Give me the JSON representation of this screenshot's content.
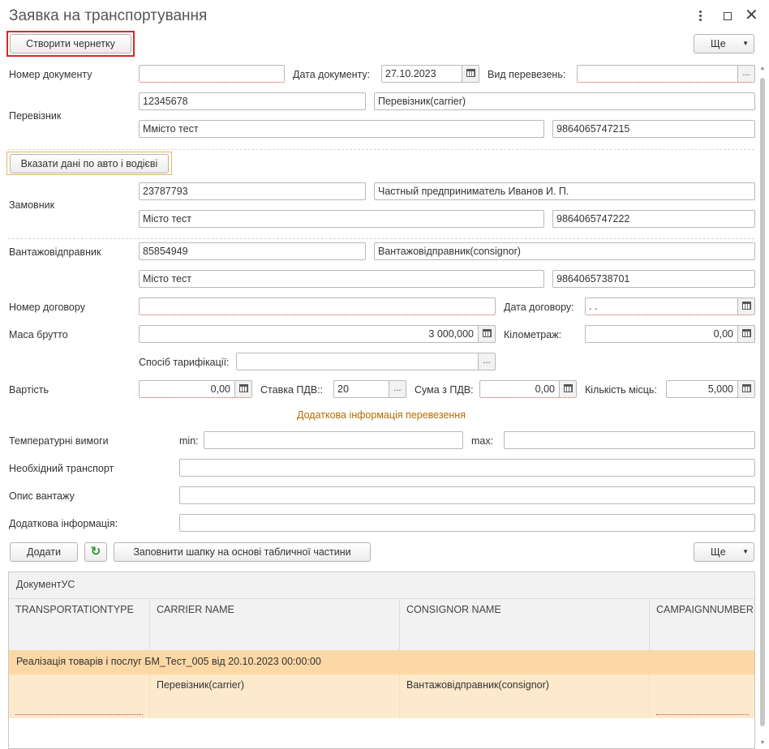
{
  "window": {
    "title": "Заявка на транспортування"
  },
  "toolbar": {
    "create_draft_label": "Створити чернетку",
    "more_label": "Ще"
  },
  "header": {
    "doc_number_label": "Номер документу",
    "doc_number_value": "",
    "doc_date_label": "Дата документу:",
    "doc_date_value": "27.10.2023",
    "transport_type_label": "Вид перевезень:",
    "transport_type_value": ""
  },
  "carrier": {
    "label": "Перевізник",
    "code": "12345678",
    "name": "Перевізник(carrier)",
    "city": "Ммісто тест",
    "phone": "9864065747215",
    "vehicle_button": "Вказати дані по авто і водієві"
  },
  "customer": {
    "label": "Замовник",
    "code": "23787793",
    "name": "Частный предприниматель Иванов И. П.",
    "city": "Місто тест",
    "phone": "9864065747222"
  },
  "consignor": {
    "label": "Вантажовідправник",
    "code": "85854949",
    "name": "Вантажовідправник(consignor)",
    "city": "Місто тест",
    "phone": "9864065738701"
  },
  "contract": {
    "number_label": "Номер договору",
    "number_value": "",
    "date_label": "Дата договору:",
    "date_value": " .  .",
    "gross_label": "Маса брутто",
    "gross_value": "3 000,000",
    "km_label": "Кілометраж:",
    "km_value": "0,00",
    "tariff_label": "Спосіб тарифікації:",
    "tariff_value": ""
  },
  "cost": {
    "label": "Вартість",
    "value": "0,00",
    "vat_rate_label": "Ставка ПДВ::",
    "vat_rate_value": "20",
    "sum_vat_label": "Сума з ПДВ:",
    "sum_vat_value": "0,00",
    "places_label": "Кількість місць:",
    "places_value": "5,000"
  },
  "extra": {
    "section_title": "Додаткова інформація перевезення",
    "temp_label": "Температурні вимоги",
    "min_label": "min:",
    "min_value": "",
    "max_label": "max:",
    "max_value": "",
    "transport_label": "Необхідний транспорт",
    "transport_value": "",
    "cargo_label": "Опис вантажу",
    "cargo_value": "",
    "info_label": "Додаткова інформація:",
    "info_value": ""
  },
  "table_toolbar": {
    "add_label": "Додати",
    "fill_label": "Заповнити шапку на основі табличної частини",
    "more_label": "Ще"
  },
  "table": {
    "group_header": "ДокументУС",
    "columns": [
      "TRANSPORTATIONTYPE",
      "CARRIER NAME",
      "CONSIGNOR NAME",
      "CAMPAIGNNUMBER"
    ],
    "group_row": "Реалізація товарів і послуг БМ_Тест_005 від 20.10.2023 00:00:00",
    "rows": [
      [
        "",
        "Перевізник(carrier)",
        "Вантажовідправник(consignor)",
        ""
      ]
    ]
  },
  "colors": {
    "accent_red": "#d42a2a",
    "section_title": "#b36b00",
    "selected_row": "#fde9cc",
    "group_row": "#fcd8a6"
  },
  "icons": {
    "menu": "kebab-icon",
    "maximize": "maximize-icon",
    "close": "close-icon",
    "refresh": "refresh-icon",
    "calendar": "calendar-icon",
    "calculator": "calculator-icon"
  }
}
